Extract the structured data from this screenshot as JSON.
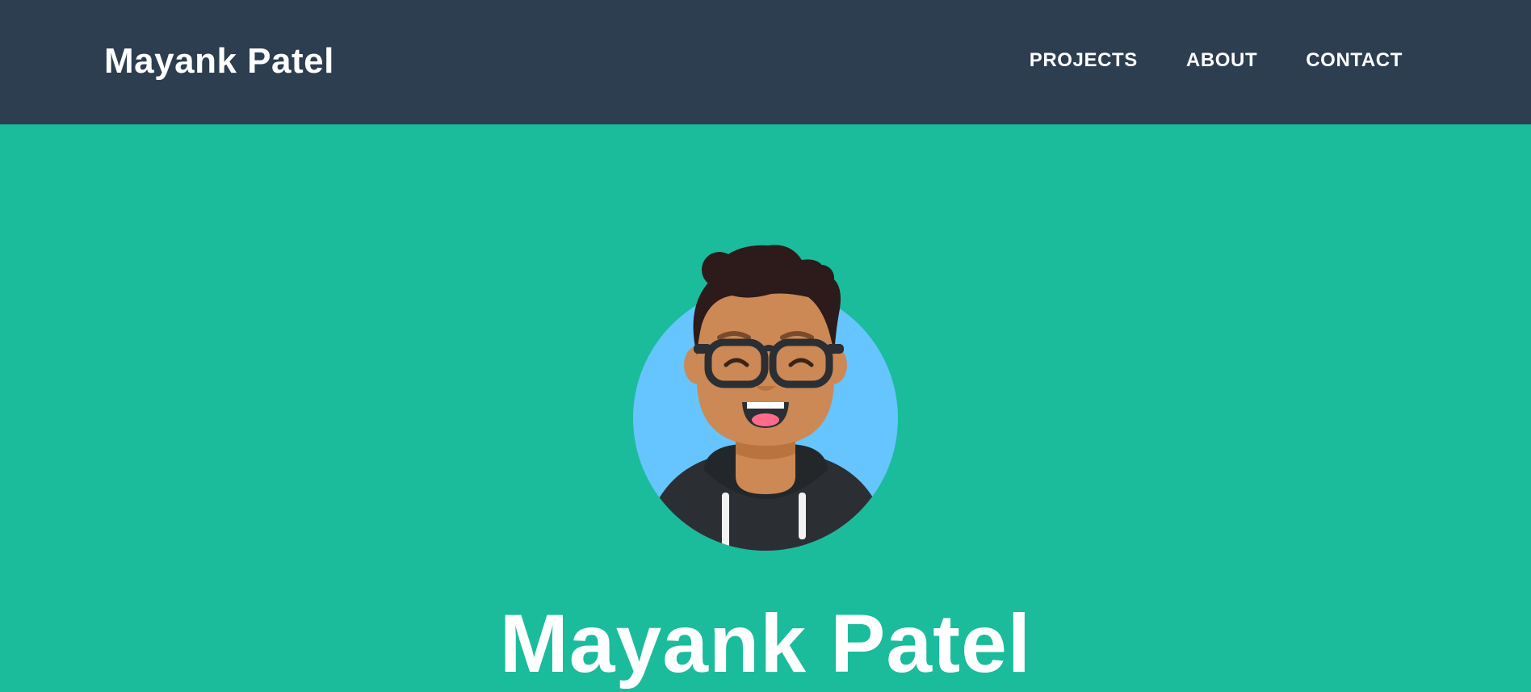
{
  "navbar": {
    "brand": "Mayank Patel",
    "links": [
      "PROJECTS",
      "ABOUT",
      "CONTACT"
    ]
  },
  "masthead": {
    "title": "Mayank Patel",
    "avatar_icon": "avatar-illustration"
  },
  "colors": {
    "navbar_bg": "#2c3e50",
    "masthead_bg": "#1abc9c",
    "text": "#ffffff",
    "avatar_circle": "#66c4ff"
  }
}
